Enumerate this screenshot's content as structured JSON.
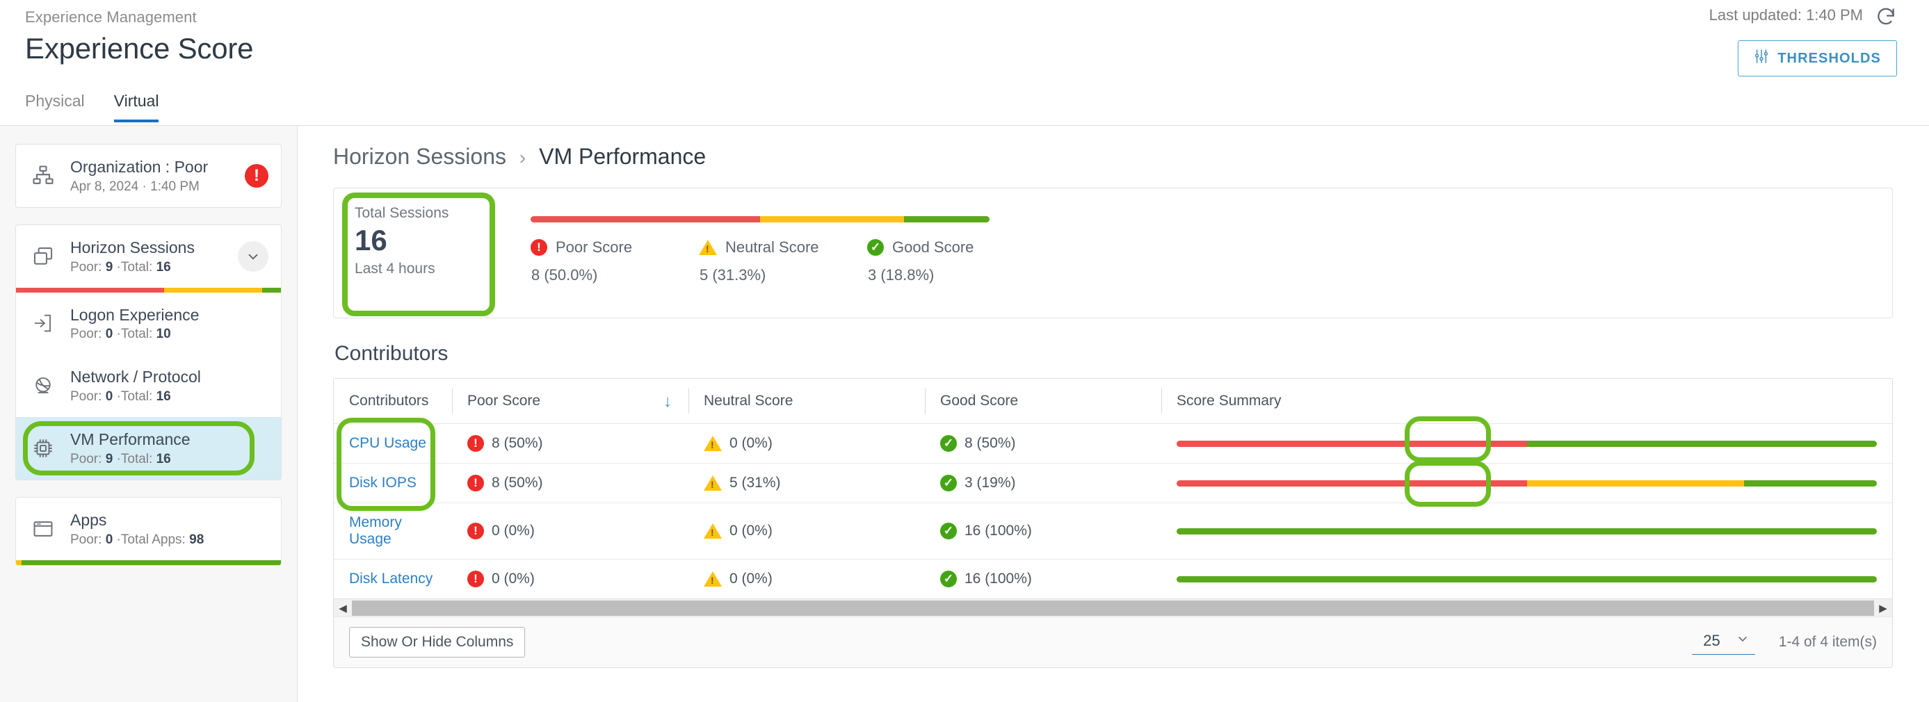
{
  "header": {
    "breadcrumb_top": "Experience Management",
    "title": "Experience Score",
    "last_updated": "Last updated: 1:40 PM",
    "refresh_icon": "refresh-icon",
    "thresholds_label": "THRESHOLDS",
    "thresholds_icon": "sliders-icon"
  },
  "tabs": [
    {
      "label": "Physical",
      "active": false
    },
    {
      "label": "Virtual",
      "active": true
    }
  ],
  "sidebar": {
    "organization": {
      "icon": "org-chart-icon",
      "title": "Organization : Poor",
      "subtitle": "Apr 8, 2024 · 1:40 PM",
      "badge_icon": "alert-exclamation-icon",
      "badge_glyph": "!"
    },
    "items": [
      {
        "icon": "windows-sessions-icon",
        "title": "Horizon Sessions",
        "sub_prefix": "Poor: ",
        "sub_poor": "9",
        "sub_mid": " ·Total: ",
        "sub_total": "16",
        "chevron_icon": "chevron-down-icon",
        "selected": false,
        "bar": [
          56,
          37,
          7
        ]
      },
      {
        "icon": "logon-arrow-icon",
        "title": "Logon Experience",
        "sub_prefix": "Poor: ",
        "sub_poor": "0",
        "sub_mid": " ·Total: ",
        "sub_total": "10",
        "selected": false
      },
      {
        "icon": "network-globe-icon",
        "title": "Network / Protocol",
        "sub_prefix": "Poor: ",
        "sub_poor": "0",
        "sub_mid": " ·Total: ",
        "sub_total": "16",
        "selected": false
      },
      {
        "icon": "cpu-chip-icon",
        "title": "VM Performance",
        "sub_prefix": "Poor: ",
        "sub_poor": "9",
        "sub_mid": " ·Total: ",
        "sub_total": "16",
        "selected": true
      }
    ],
    "apps": {
      "icon": "app-window-icon",
      "title": "Apps",
      "sub_prefix": "Poor: ",
      "sub_poor": "0",
      "sub_mid": " ·Total Apps: ",
      "sub_total": "98",
      "bar": [
        0,
        2,
        98
      ]
    }
  },
  "content": {
    "breadcrumb": {
      "parent": "Horizon Sessions",
      "separator": "›",
      "current": "VM Performance"
    },
    "summary": {
      "total_label": "Total Sessions",
      "total_value": "16",
      "total_period": "Last 4 hours",
      "legend": [
        {
          "icon": "alert-exclamation-icon",
          "label": "Poor Score",
          "value": "8 (50.0%)",
          "color": "#f05050"
        },
        {
          "icon": "warning-triangle-icon",
          "label": "Neutral Score",
          "value": "5 (31.3%)",
          "color": "#ffc20e"
        },
        {
          "icon": "check-circle-icon",
          "label": "Good Score",
          "value": "3 (18.8%)",
          "color": "#5aa81c"
        }
      ],
      "bar_segments": [
        50.0,
        31.3,
        18.8
      ]
    },
    "contributors_title": "Contributors",
    "table": {
      "columns": [
        "Contributors",
        "Poor Score",
        "Neutral Score",
        "Good Score",
        "Score Summary"
      ],
      "sort_column": "Poor Score",
      "sort_icon": "arrow-down-icon",
      "rows": [
        {
          "name": "CPU Usage",
          "poor": "8 (50%)",
          "neutral": "0 (0%)",
          "good": "8 (50%)",
          "bar": [
            50,
            0,
            50
          ]
        },
        {
          "name": "Disk IOPS",
          "poor": "8 (50%)",
          "neutral": "5 (31%)",
          "good": "3 (19%)",
          "bar": [
            50,
            31,
            19
          ]
        },
        {
          "name": "Memory Usage",
          "poor": "0 (0%)",
          "neutral": "0 (0%)",
          "good": "16 (100%)",
          "bar": [
            0,
            0,
            100
          ]
        },
        {
          "name": "Disk Latency",
          "poor": "0 (0%)",
          "neutral": "0 (0%)",
          "good": "16 (100%)",
          "bar": [
            0,
            0,
            100
          ]
        }
      ],
      "scroll_left_icon": "triangle-left-icon",
      "scroll_right_icon": "triangle-right-icon",
      "show_hide_columns": "Show Or Hide Columns",
      "page_size": "25",
      "page_size_icon": "chevron-down-icon",
      "page_info": "1-4 of 4 item(s)"
    }
  },
  "colors": {
    "poor": "#f05050",
    "neutral": "#ffc20e",
    "good": "#5aa81c",
    "accent": "#2e7fc4",
    "highlight": "#6bbd20"
  }
}
